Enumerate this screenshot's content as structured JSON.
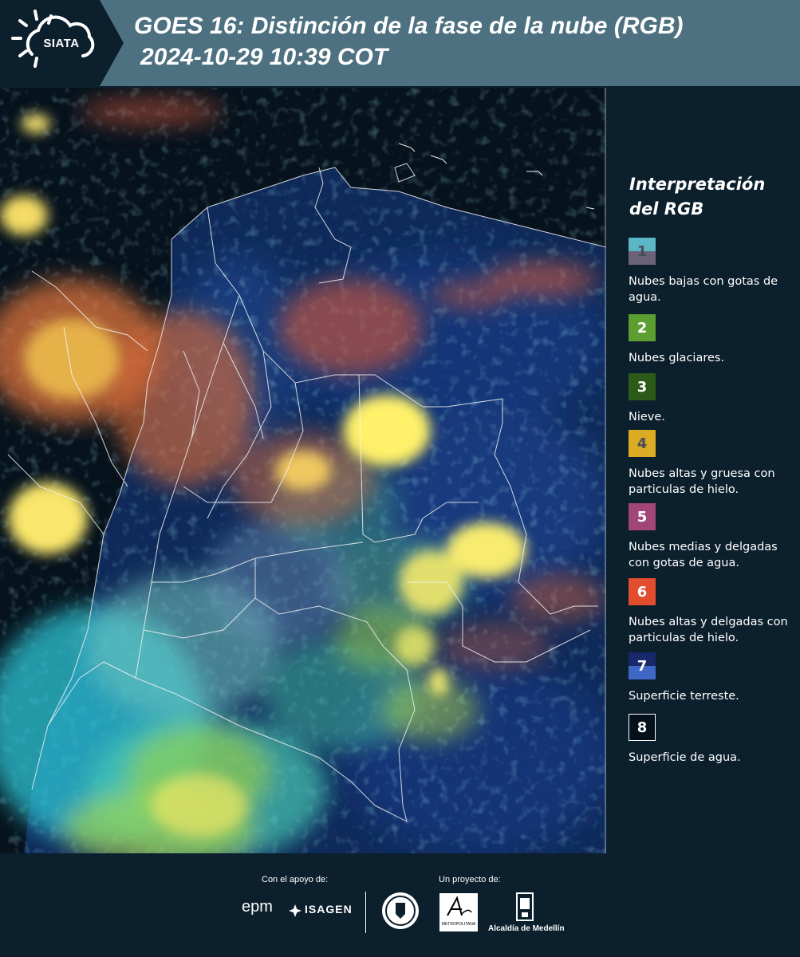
{
  "header": {
    "logo_text": "SIATA",
    "title_line1": "GOES 16: Distinción de la fase de la nube (RGB)",
    "title_line2": "2024-10-29 10:39 COT"
  },
  "map": {
    "icon": "satellite-rgb-image"
  },
  "legend": {
    "title": "Interpretación del RGB",
    "items": [
      {
        "number": "1",
        "label": "Nubes bajas con gotas de agua.",
        "color_top": "#5bb6c6",
        "color_bottom": "#6b6279"
      },
      {
        "number": "2",
        "label": "Nubes glaciares.",
        "color": "#5c9e2f"
      },
      {
        "number": "3",
        "label": "Nieve.",
        "color": "#2c5a18"
      },
      {
        "number": "4",
        "label": "Nubes altas y gruesa con particulas de hielo.",
        "color": "#dcab24"
      },
      {
        "number": "5",
        "label": "Nubes medias y delgadas con gotas de agua.",
        "color": "#a04678"
      },
      {
        "number": "6",
        "label": "Nubes altas y delgadas con particulas de hielo.",
        "color": "#e14d2d"
      },
      {
        "number": "7",
        "label": "Superficie terreste.",
        "color_top": "#17296a",
        "color_bottom": "#3f67c6"
      },
      {
        "number": "8",
        "label": "Superficie de agua.",
        "color": "#04101a"
      }
    ]
  },
  "footer": {
    "support_label": "Con el apoyo de:",
    "project_label": "Un proyecto de:",
    "epm": "epm",
    "isagen": "ISAGEN",
    "area_label": "METROPOLITANA",
    "alcaldia": "Alcaldía de Medellín"
  }
}
